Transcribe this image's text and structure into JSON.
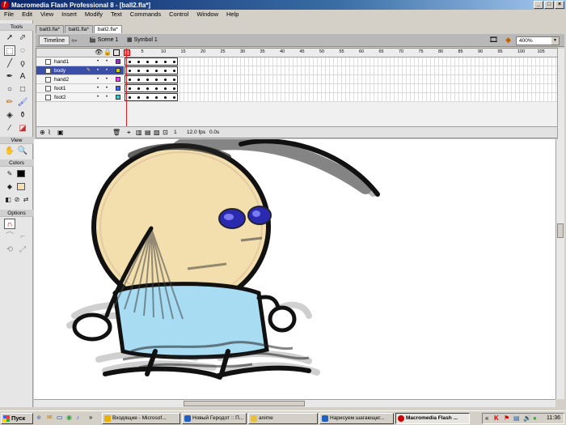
{
  "titlebar": {
    "title": "Macromedia Flash Professional 8 - [ball2.fla*]"
  },
  "menu": [
    "File",
    "Edit",
    "View",
    "Insert",
    "Modify",
    "Text",
    "Commands",
    "Control",
    "Window",
    "Help"
  ],
  "tools": {
    "tools_label": "Tools",
    "view_label": "View",
    "colors_label": "Colors",
    "options_label": "Options"
  },
  "doc_tabs": [
    "ball3.fla*",
    "ball1.fla*",
    "ball2.fla*"
  ],
  "timeline": {
    "timeline_button": "Timeline",
    "scene": "Scene 1",
    "symbol": "Symbol 1",
    "zoom": "400%",
    "ruler": [
      "1",
      "5",
      "10",
      "15",
      "20",
      "25",
      "30",
      "35",
      "40",
      "45",
      "50",
      "55",
      "60",
      "65",
      "70",
      "75",
      "80",
      "85",
      "90",
      "95",
      "100",
      "105"
    ],
    "layers": [
      {
        "name": "hand1",
        "color": "#9933cc"
      },
      {
        "name": "body",
        "color": "#cccc00"
      },
      {
        "name": "hand2",
        "color": "#ff33ff"
      },
      {
        "name": "foot1",
        "color": "#3366ff"
      },
      {
        "name": "foot2",
        "color": "#33cccc"
      }
    ],
    "selected_layer": "body",
    "current_frame": "1",
    "frame_rate": "12.0 fps",
    "elapsed": "0.0s"
  },
  "taskbar": {
    "start": "Пуск",
    "tasks": [
      "Входящие - Microsof...",
      "Новый Геродот :: П...",
      "anime",
      "Нарисуем шагающег...",
      "Macromedia Flash ..."
    ],
    "active_task": "Macromedia Flash ...",
    "clock": "11:36"
  }
}
